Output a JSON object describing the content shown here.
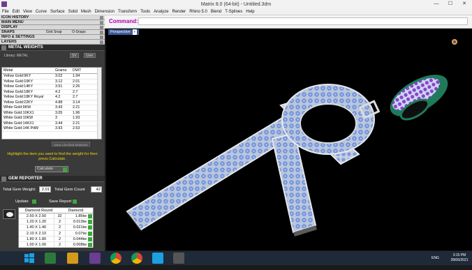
{
  "window": {
    "title": "Matrix 8.0 (64-bit) - Untitled.3dm",
    "minimize": "—",
    "maximize": "☐",
    "close": "✕"
  },
  "menu": [
    "File",
    "Edit",
    "View",
    "Curve",
    "Surface",
    "Solid",
    "Mesh",
    "Dimension",
    "Transform",
    "Tools",
    "Analyze",
    "Render",
    "Rhino 5.0",
    "Blend",
    "T-Splines",
    "Help"
  ],
  "left_panel": {
    "sections": [
      "ICON HISTORY",
      "MAIN MENU",
      "DISPLAY",
      "SNAPS",
      "INFO & SETTINGS",
      "LAYERS"
    ],
    "snaps_grid": "Grid Snap",
    "snaps_osnap": "O-Snaps",
    "metal_weights": {
      "title": "METAL WEIGHTS",
      "library_label": "Library: METAL",
      "library_chip": "SV",
      "user_chip": "User",
      "columns": [
        "Metal",
        "Grams",
        "DWT"
      ],
      "rows": [
        [
          "Yellow Gold:9KY",
          "3.02",
          "1.94"
        ],
        [
          "Yellow Gold:10KY",
          "3.12",
          "2.01"
        ],
        [
          "Yellow Gold:14KY",
          "3.51",
          "2.26"
        ],
        [
          "Yellow Gold:18KY",
          "4.2",
          "2.7"
        ],
        [
          "Yellow Gold:18KY Royal",
          "4.2",
          "2.7"
        ],
        [
          "Yellow Gold:22KY",
          "4.88",
          "3.14"
        ],
        [
          "White Gold:9KW",
          "3.43",
          "2.21"
        ],
        [
          "White Gold:10KX1",
          "3.05",
          "1.96"
        ],
        [
          "White Gold:10KW",
          "3",
          "1.93"
        ],
        [
          "White Gold:14KX1",
          "3.44",
          "2.21"
        ],
        [
          "White Gold:14K PdW",
          "3.93",
          "2.53"
        ]
      ],
      "save_button": "Save Checked Materials",
      "hint": "Highlight the item you want to find the weight for then press Calculate.",
      "calculate": "Calculate"
    },
    "gem_reporter": {
      "title": "GEM REPORTER",
      "total_weight_label": "Total Gem Weight:",
      "total_weight": "2.01",
      "total_count_label": "Total Gem Count",
      "total_count": "42",
      "update": "Update",
      "save_report": "Save Report",
      "columns": [
        "Diamond Round",
        "Diamond"
      ],
      "rows": [
        {
          "size": "2.50 X 2.50",
          "count": "32",
          "weight": "1.85tw"
        },
        {
          "size": "1.20 X 1.20",
          "count": "2",
          "weight": "0.013tw"
        },
        {
          "size": "1.40 X 1.40",
          "count": "2",
          "weight": "0.021tw"
        },
        {
          "size": "2.10 X 2.10",
          "count": "2",
          "weight": "0.07tw"
        },
        {
          "size": "1.80 X 1.80",
          "count": "2",
          "weight": "0.044tw"
        },
        {
          "size": "1.00 X 1.00",
          "count": "2",
          "weight": "0.008tw"
        }
      ]
    }
  },
  "command": {
    "label": "Command:",
    "value": ""
  },
  "viewport": {
    "tab": "Perspective"
  },
  "taskbar": {
    "language": "ENG",
    "time": "3:15 PM",
    "date": "28/06/2021"
  },
  "icons": [
    "matrix-app-icon",
    "windows-start-icon",
    "folder-icon",
    "excel-icon",
    "chrome-icon",
    "matrix-taskbar-icon",
    "gear-icon"
  ]
}
